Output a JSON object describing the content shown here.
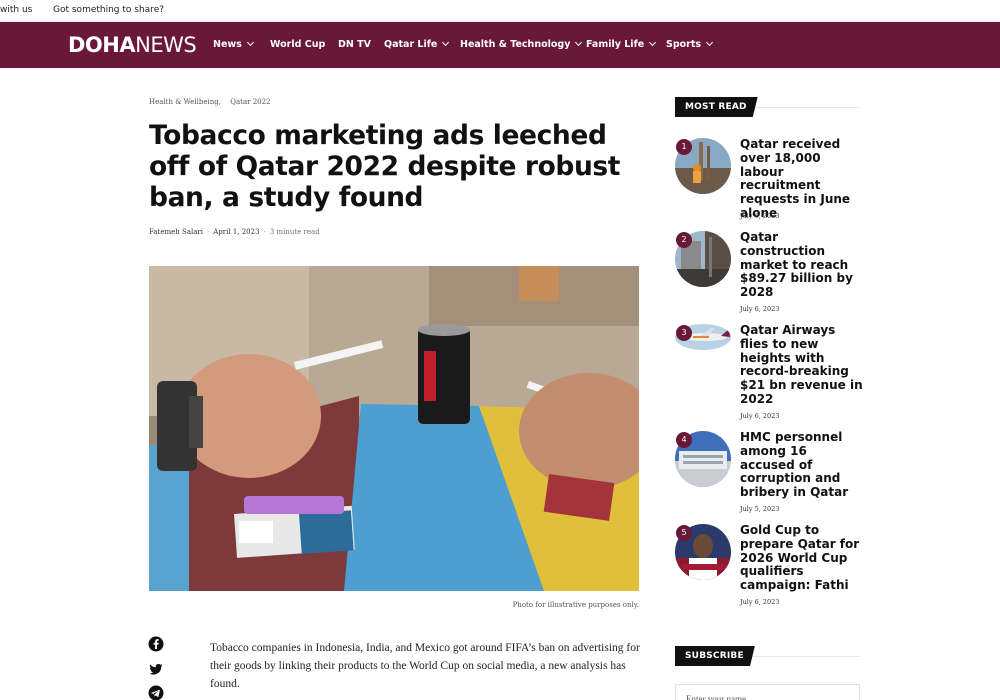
{
  "topbar": {
    "left_link": "with us",
    "share_link": "Got something to share?"
  },
  "nav": {
    "logo_bold": "DOHA",
    "logo_light": "NEWS",
    "items": [
      {
        "label": "News",
        "dropdown": true
      },
      {
        "label": "World Cup",
        "dropdown": false
      },
      {
        "label": "DN TV",
        "dropdown": false
      },
      {
        "label": "Qatar Life",
        "dropdown": true
      },
      {
        "label": "Health & Technology",
        "dropdown": true
      },
      {
        "label": "Family Life",
        "dropdown": true
      },
      {
        "label": "Sports",
        "dropdown": true
      }
    ],
    "background_color": "#691837"
  },
  "article": {
    "categories": [
      "Health & Wellbeing,",
      "Qatar 2022"
    ],
    "title": "Tobacco marketing ads leeched off of Qatar 2022 despite robust ban, a study found",
    "author": "Fatemeh Salari",
    "date": "April 1, 2023",
    "read_time": "3 minute read",
    "image_caption": "Photo for illustrative purposes only.",
    "share_icons": [
      "facebook-icon",
      "twitter-icon",
      "telegram-icon"
    ],
    "lead_paragraph": "Tobacco companies in Indonesia, India, and Mexico got around FIFA’s ban on advertising for their goods by linking their products to the World Cup on social media, a new analysis has found."
  },
  "sidebar": {
    "most_read_heading": "MOST READ",
    "most_read": [
      {
        "rank": "1",
        "title": "Qatar received over 18,000 labour recruitment requests in June alone",
        "date": "July 6, 2023"
      },
      {
        "rank": "2",
        "title": "Qatar construction market to reach $89.27 billion by 2028",
        "date": "July 6, 2023"
      },
      {
        "rank": "3",
        "title": "Qatar Airways flies to new heights with record-breaking $21 bn revenue in 2022",
        "date": "July 6, 2023"
      },
      {
        "rank": "4",
        "title": "HMC personnel among 16 accused of corruption and bribery in Qatar",
        "date": "July 5, 2023"
      },
      {
        "rank": "5",
        "title": "Gold Cup to prepare Qatar for 2026 World Cup qualifiers campaign: Fathi",
        "date": "July 6, 2023"
      }
    ],
    "subscribe_heading": "SUBSCRIBE",
    "subscribe_placeholder": "Enter your name"
  }
}
